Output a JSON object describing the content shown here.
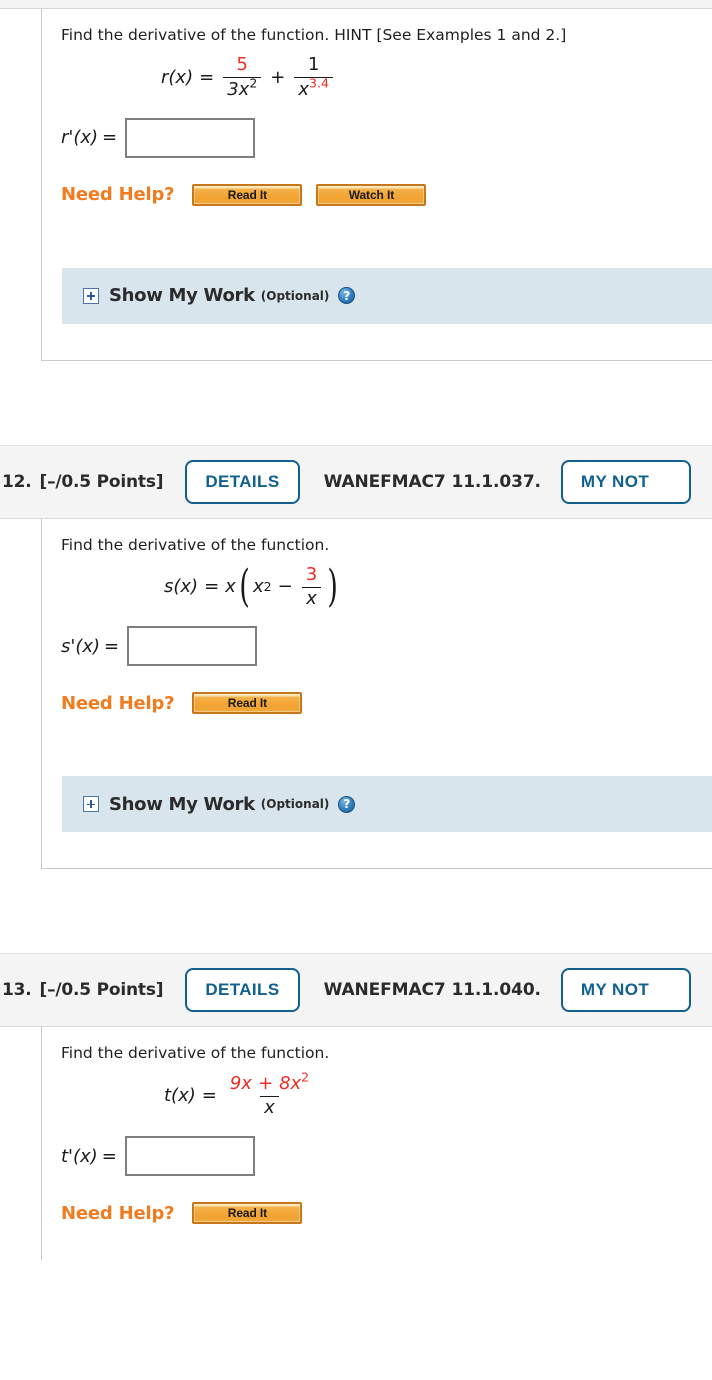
{
  "page": {
    "platform_note": "WebAssign-style online homework question list"
  },
  "questions": [
    {
      "id": "q11",
      "header_visible": false,
      "prompt": "Find the derivative of the function. HINT [See Examples 1 and 2.]",
      "function_label": "r(x)",
      "equals": "=",
      "expression_parts": {
        "frac1_num": "5",
        "frac1_den_coeff": "3x",
        "frac1_den_exp": "2",
        "operator": "+",
        "frac2_num": "1",
        "frac2_den_base": "x",
        "frac2_den_exp": "3.4"
      },
      "answer_label": "r'(x)",
      "answer_equals": "=",
      "answer_value": "",
      "need_help_label": "Need Help?",
      "help_buttons": [
        "Read It",
        "Watch It"
      ],
      "show_my_work": {
        "title": "Show My Work",
        "optional": "(Optional)",
        "help_icon_text": "?",
        "expander": "+"
      }
    },
    {
      "id": "q12",
      "header_visible": true,
      "number": "12.",
      "points": "[–/0.5 Points]",
      "details_label": "DETAILS",
      "code": "WANEFMAC7 11.1.037.",
      "notes_label": "MY NOT",
      "prompt": "Find the derivative of the function.",
      "function_label": "s(x)",
      "equals": "=",
      "expression_parts": {
        "outer_factor": "x",
        "inner_base": "x",
        "inner_exp": "2",
        "operator": "−",
        "frac_num": "3",
        "frac_den": "x"
      },
      "answer_label": "s'(x)",
      "answer_equals": "=",
      "answer_value": "",
      "need_help_label": "Need Help?",
      "help_buttons": [
        "Read It"
      ],
      "show_my_work": {
        "title": "Show My Work",
        "optional": "(Optional)",
        "help_icon_text": "?",
        "expander": "+"
      }
    },
    {
      "id": "q13",
      "header_visible": true,
      "number": "13.",
      "points": "[–/0.5 Points]",
      "details_label": "DETAILS",
      "code": "WANEFMAC7 11.1.040.",
      "notes_label": "MY NOT",
      "prompt": "Find the derivative of the function.",
      "function_label": "t(x)",
      "equals": "=",
      "expression_parts": {
        "num_a": "9x",
        "num_op": "+",
        "num_b": "8x",
        "num_b_exp": "2",
        "den": "x"
      },
      "answer_label": "t'(x)",
      "answer_equals": "=",
      "answer_value": "",
      "need_help_label": "Need Help?",
      "help_buttons": [
        "Read It"
      ]
    }
  ],
  "colors": {
    "accent_red": "#ef2b23",
    "need_help_orange": "#f07c1f",
    "button_blue": "#11608f",
    "smw_band": "#d8e5ec"
  }
}
